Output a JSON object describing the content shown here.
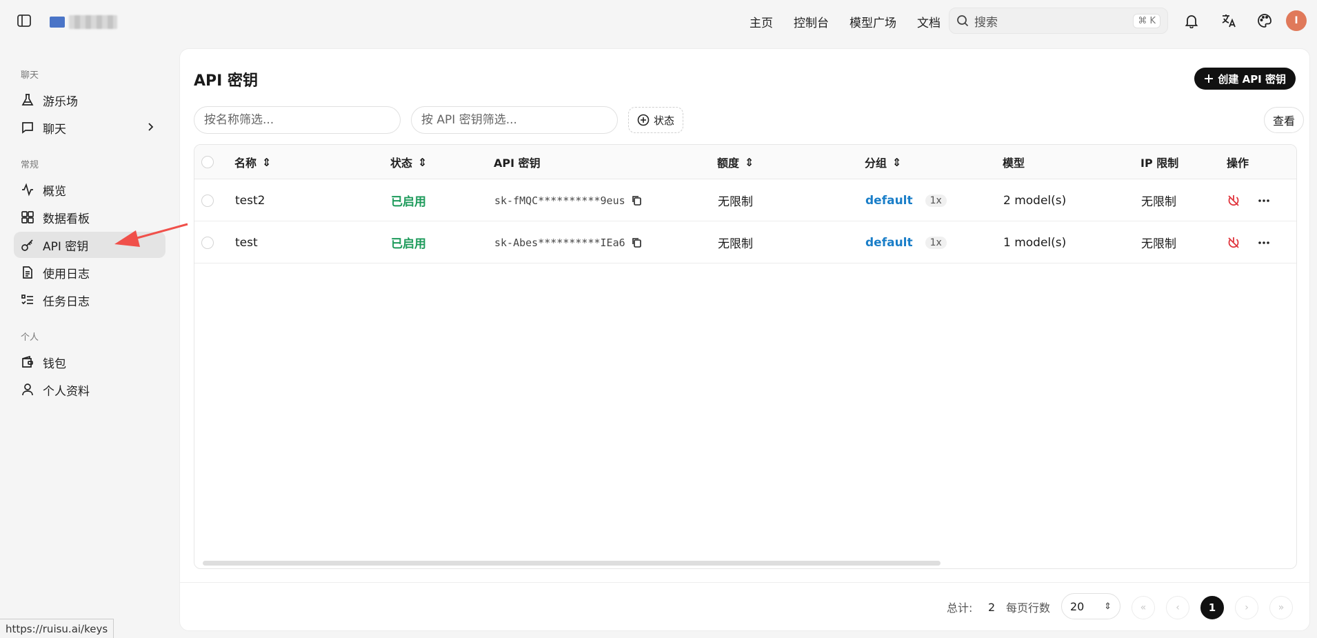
{
  "header": {
    "nav": [
      "主页",
      "控制台",
      "模型广场",
      "文档"
    ],
    "search_placeholder": "搜索",
    "search_shortcut": "⌘ K",
    "avatar_letter": "I"
  },
  "sidebar": {
    "sections": [
      {
        "label": "聊天",
        "items": [
          {
            "label": "游乐场",
            "icon": "flask-icon"
          },
          {
            "label": "聊天",
            "icon": "chat-icon",
            "has_chevron": true
          }
        ]
      },
      {
        "label": "常规",
        "items": [
          {
            "label": "概览",
            "icon": "activity-icon"
          },
          {
            "label": "数据看板",
            "icon": "dashboard-icon"
          },
          {
            "label": "API 密钥",
            "icon": "key-icon",
            "active": true
          },
          {
            "label": "使用日志",
            "icon": "document-icon"
          },
          {
            "label": "任务日志",
            "icon": "list-check-icon"
          }
        ]
      },
      {
        "label": "个人",
        "items": [
          {
            "label": "钱包",
            "icon": "wallet-icon"
          },
          {
            "label": "个人资料",
            "icon": "user-icon"
          }
        ]
      }
    ]
  },
  "page": {
    "title": "API 密钥",
    "create_button": "创建 API 密钥",
    "filter_name_placeholder": "按名称筛选...",
    "filter_key_placeholder": "按 API 密钥筛选...",
    "status_filter": "状态",
    "view_button": "查看"
  },
  "table": {
    "columns": [
      "名称",
      "状态",
      "API 密钥",
      "额度",
      "分组",
      "模型",
      "IP 限制",
      "操作"
    ],
    "rows": [
      {
        "name": "test2",
        "status": "已启用",
        "key": "sk-fMQC**********9eus",
        "quota": "无限制",
        "group": "default",
        "ratio": "1x",
        "models": "2 model(s)",
        "ip": "无限制"
      },
      {
        "name": "test",
        "status": "已启用",
        "key": "sk-Abes**********IEa6",
        "quota": "无限制",
        "group": "default",
        "ratio": "1x",
        "models": "1 model(s)",
        "ip": "无限制"
      }
    ]
  },
  "footer": {
    "total_label": "总计:",
    "total_value": "2",
    "rows_per_page_label": "每页行数",
    "rows_per_page": "20",
    "current_page": "1"
  },
  "status_url": "https://ruisu.ai/keys",
  "colors": {
    "accent": "#111111",
    "enabled": "#1c9a5a",
    "link": "#1a7ec8",
    "annotation_arrow": "#f0504a",
    "avatar": "#e0795a"
  }
}
